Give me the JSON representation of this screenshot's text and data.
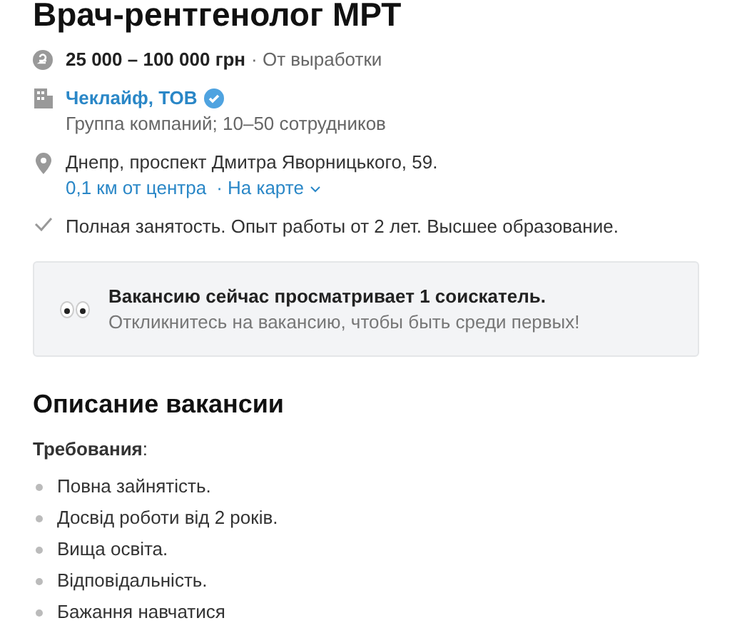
{
  "title": "Врач-рентгенолог МРТ",
  "salary": {
    "amount": "25 000 – 100 000 грн",
    "note": "· От выработки"
  },
  "company": {
    "name": "Чеклайф, ТОВ",
    "verified": true,
    "details": "Группа компаний; 10–50 сотрудников"
  },
  "address": {
    "text": "Днепр, проспект Дмитра Яворницького, 59.",
    "distance": "0,1 км от центра",
    "map_link": "· На карте"
  },
  "conditions": "Полная занятость. Опыт работы от 2 лет. Высшее образование.",
  "notice": {
    "title": "Вакансию сейчас просматривает 1 соискатель.",
    "text": "Откликнитесь на вакансию, чтобы быть среди первых!"
  },
  "description": {
    "heading": "Описание вакансии",
    "subheading": "**Требования**:",
    "items": [
      "Повна зайнятість.",
      "Досвід роботи від 2 років.",
      "Вища освіта.",
      "Відповідальність.",
      "Бажання навчатися"
    ]
  }
}
